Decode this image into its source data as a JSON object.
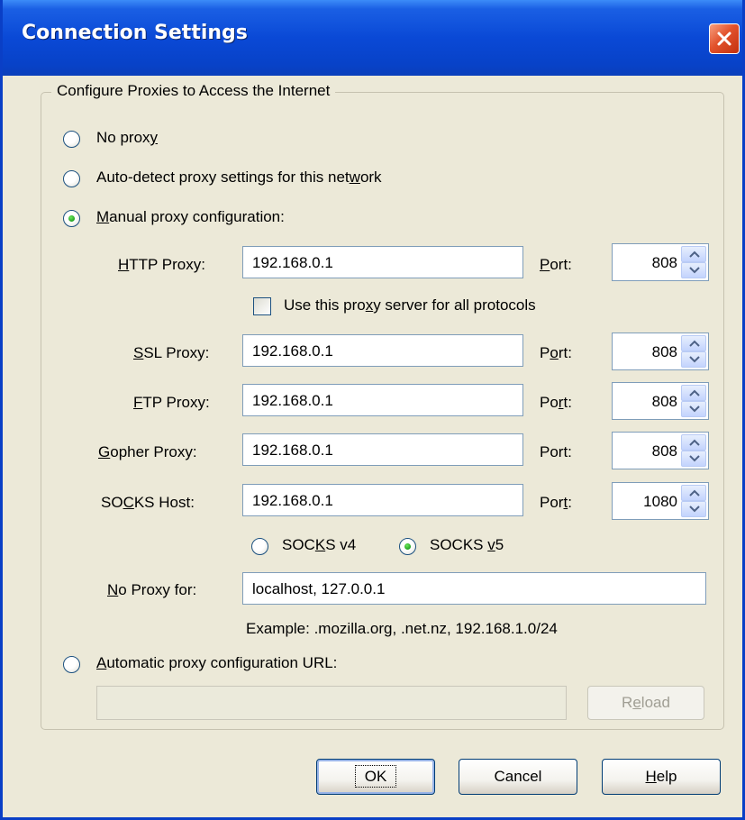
{
  "window": {
    "title": "Connection Settings"
  },
  "group": {
    "label": "Configure Proxies to Access the Internet"
  },
  "options": {
    "no_proxy": {
      "label_pre": "No prox",
      "label_key": "y",
      "label_post": ""
    },
    "auto_detect": {
      "label_pre": "Auto-detect proxy settings for this net",
      "label_key": "w",
      "label_post": "ork"
    },
    "manual": {
      "label_pre": "",
      "label_key": "M",
      "label_post": "anual proxy configuration:"
    },
    "auto_url": {
      "label_pre": "",
      "label_key": "A",
      "label_post": "utomatic proxy configuration URL:"
    }
  },
  "http": {
    "label_key": "H",
    "label_post": "TTP Proxy:",
    "value": "192.168.0.1",
    "port_pre": "",
    "port_key": "P",
    "port_post": "ort:",
    "port": "808"
  },
  "use_all": {
    "label_pre": "Use this pro",
    "label_key": "x",
    "label_post": "y server for all protocols"
  },
  "ssl": {
    "label_key": "S",
    "label_post": "SL Proxy:",
    "value": "192.168.0.1",
    "port_pre": "P",
    "port_key": "o",
    "port_post": "rt:",
    "port": "808"
  },
  "ftp": {
    "label_key": "F",
    "label_post": "TP Proxy:",
    "value": "192.168.0.1",
    "port_pre": "Po",
    "port_key": "r",
    "port_post": "t:",
    "port": "808"
  },
  "gopher": {
    "label_key": "G",
    "label_post": "opher Proxy:",
    "value": "192.168.0.1",
    "port_pre": "Port:",
    "port_key": "",
    "port_post": "",
    "port": "808"
  },
  "socks": {
    "label_pre": "SO",
    "label_key": "C",
    "label_post": "KS Host:",
    "value": "192.168.0.1",
    "port_pre": "Por",
    "port_key": "t",
    "port_post": ":",
    "port": "1080"
  },
  "socks_ver": {
    "v4": {
      "label_pre": "SOC",
      "label_key": "K",
      "label_post": "S v4"
    },
    "v5": {
      "label_pre": "SOCKS ",
      "label_key": "v",
      "label_post": "5"
    }
  },
  "no_proxy_for": {
    "label_key": "N",
    "label_post": "o Proxy for:",
    "value": "localhost, 127.0.0.1",
    "example": "Example: .mozilla.org, .net.nz, 192.168.1.0/24"
  },
  "auto_url_field": {
    "value": ""
  },
  "reload": {
    "pre": "R",
    "key": "e",
    "post": "load"
  },
  "buttons": {
    "ok": "OK",
    "cancel": "Cancel",
    "help_key": "H",
    "help_post": "elp"
  },
  "colors": {
    "titlebar": "#0a49d6",
    "dialog_bg": "#ece9d8",
    "close": "#e2522c",
    "radio_dot": "#21a121"
  }
}
